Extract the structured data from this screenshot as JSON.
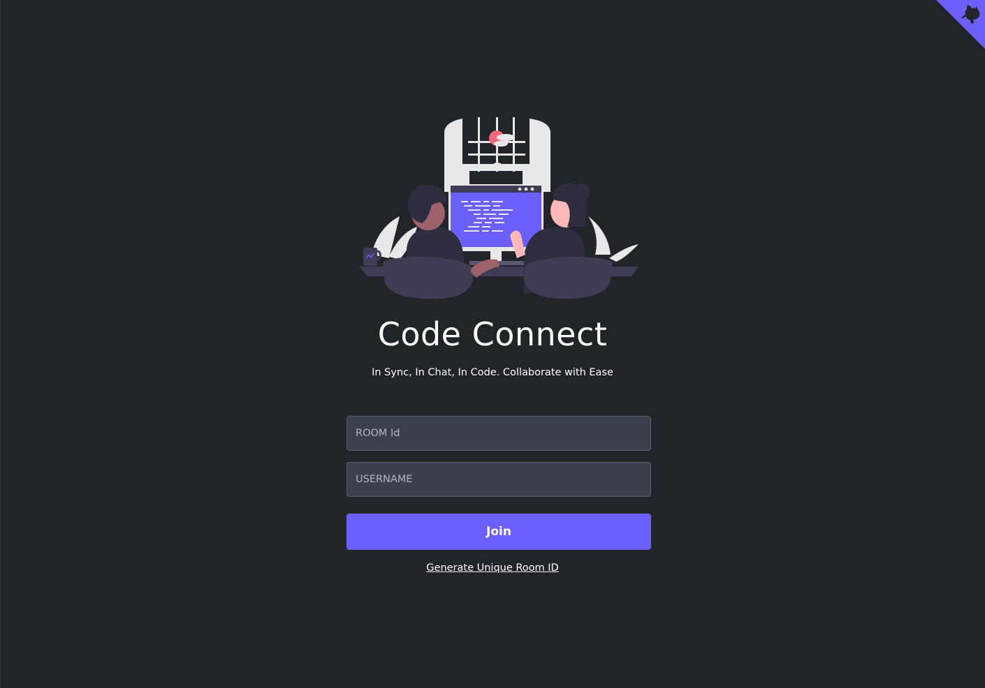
{
  "app": {
    "title": "Code Connect",
    "tagline": "In Sync, In Chat, In Code. Collaborate with Ease"
  },
  "form": {
    "room_placeholder": "ROOM Id",
    "room_value": "",
    "username_placeholder": "USERNAME",
    "username_value": "",
    "join_label": "Join",
    "generate_link": "Generate Unique Room ID"
  },
  "corner": {
    "icon": "github-octocat-icon"
  },
  "colors": {
    "background": "#212429",
    "accent": "#6c5ffc",
    "input_bg": "#3d3f4b",
    "text": "#ffffff"
  }
}
